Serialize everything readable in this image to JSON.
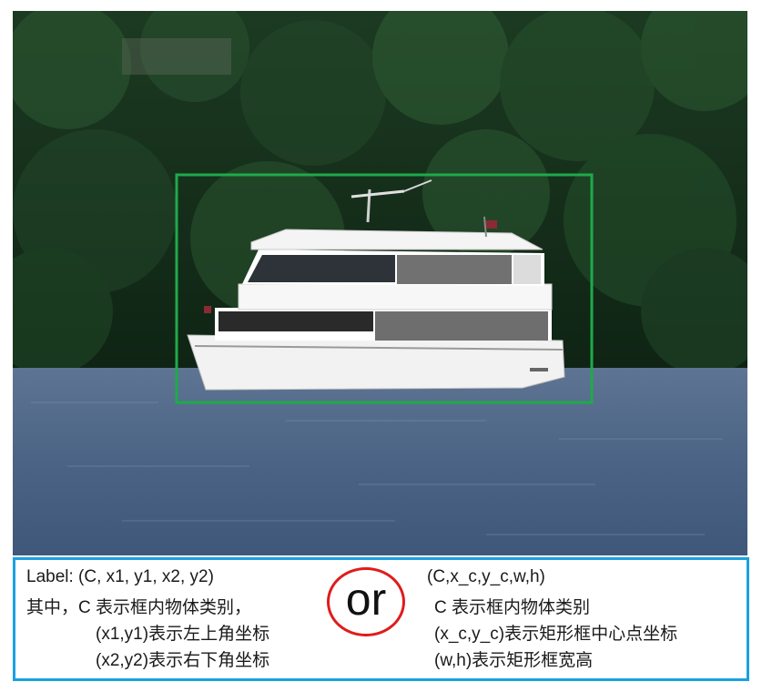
{
  "photo": {
    "bounding_box_color": "#1faa4a",
    "objects": [
      "yacht-boat",
      "tree-background",
      "river-water"
    ]
  },
  "caption": {
    "border_color": "#1aa1e0",
    "left": {
      "line1": "Label: (C, x1, y1, x2, y2)",
      "line2": "其中，C 表示框内物体类别，",
      "line3": "(x1,y1)表示左上角坐标",
      "line4": "(x2,y2)表示右下角坐标"
    },
    "or_label": "or",
    "or_color": "#e01b1b",
    "right": {
      "line1": "(C,x_c,y_c,w,h)",
      "line2": "C 表示框内物体类别",
      "line3": "(x_c,y_c)表示矩形框中心点坐标",
      "line4": "(w,h)表示矩形框宽高"
    }
  }
}
